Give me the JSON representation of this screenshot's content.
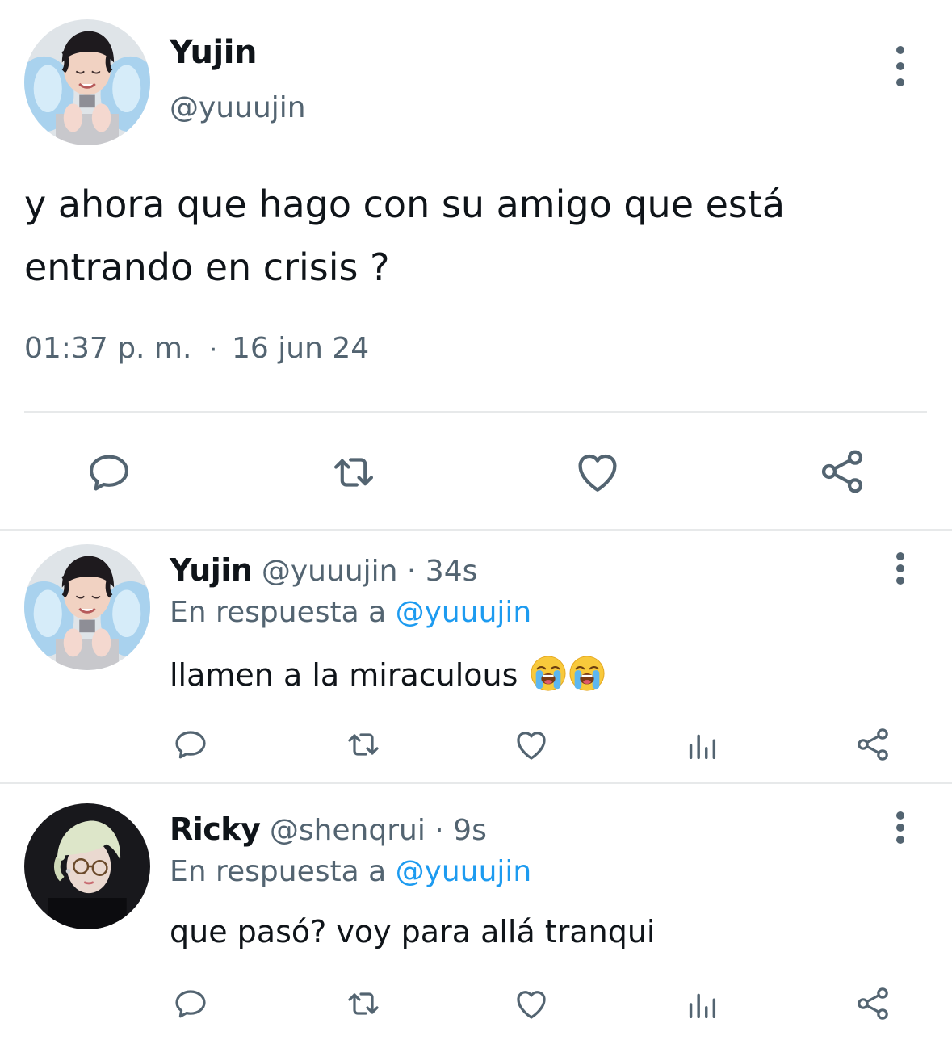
{
  "main_tweet": {
    "author_name": "Yujin",
    "author_handle": "@yuuujin",
    "text_line1": "y ahora que hago con su amigo que está",
    "text_line2": "entrando en crisis ?",
    "time": "01:37 p. m.",
    "separator": "·",
    "date": "16 jun 24",
    "actions": [
      "reply-icon",
      "retweet-icon",
      "like-icon",
      "share-icon"
    ]
  },
  "replies": [
    {
      "author_name": "Yujin",
      "author_handle": "@yuuujin",
      "age": "· 34s",
      "reply_prefix": "En respuesta a",
      "reply_mention": "@yuuujin",
      "text": "llamen a la miraculous",
      "emojis": [
        "loudly-crying-face",
        "loudly-crying-face"
      ],
      "actions": [
        "reply-icon",
        "retweet-icon",
        "like-icon",
        "analytics-icon",
        "share-icon"
      ]
    },
    {
      "author_name": "Ricky",
      "author_handle": "@shenqrui",
      "age": "· 9s",
      "reply_prefix": "En respuesta a",
      "reply_mention": "@yuuujin",
      "text": "que pasó? voy para allá tranqui",
      "actions": [
        "reply-icon",
        "retweet-icon",
        "like-icon",
        "analytics-icon",
        "share-icon"
      ]
    }
  ],
  "colors": {
    "text_primary": "#0f1419",
    "text_secondary": "#536471",
    "mention": "#1d9bf0",
    "divider": "#e7e9ea"
  }
}
